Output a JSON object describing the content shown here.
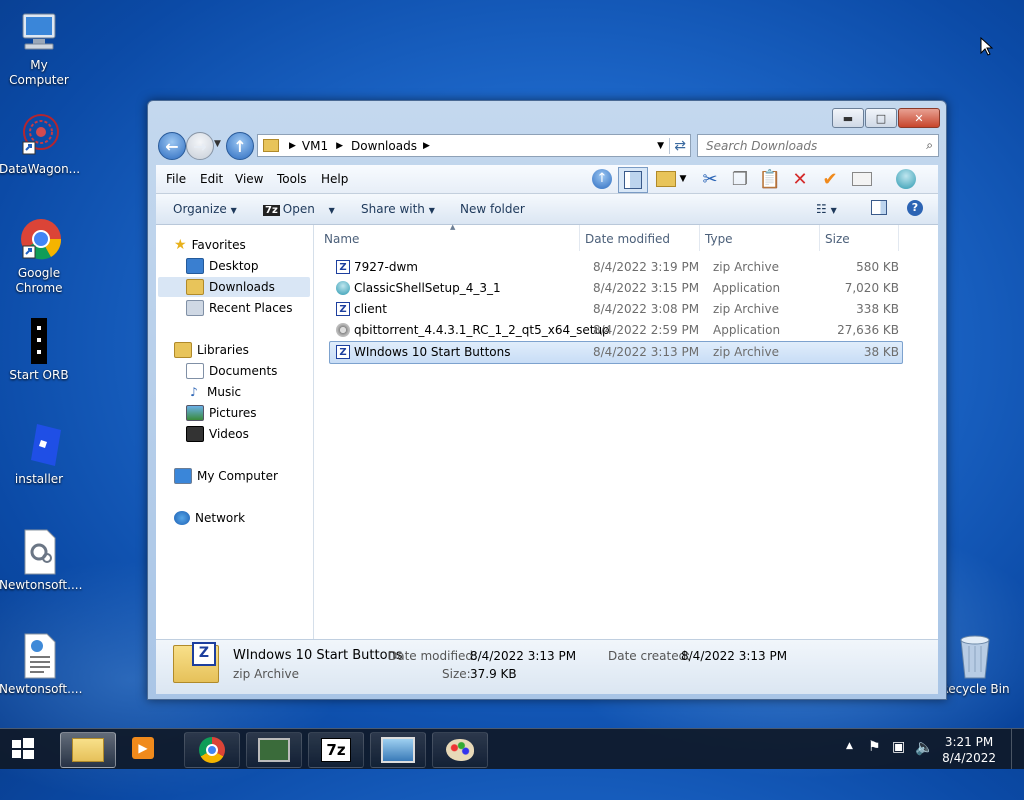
{
  "desktop": {
    "icons": [
      {
        "label": "My Computer"
      },
      {
        "label": "DataWagon..."
      },
      {
        "label": "Google Chrome"
      },
      {
        "label": "Start ORB"
      },
      {
        "label": "installer"
      },
      {
        "label": "Newtonsoft...."
      },
      {
        "label": "Newtonsoft...."
      },
      {
        "label": "Recycle Bin"
      }
    ]
  },
  "explorer": {
    "address": {
      "segments": [
        "VM1",
        "Downloads"
      ]
    },
    "search_placeholder": "Search Downloads",
    "menu": [
      "File",
      "Edit",
      "View",
      "Tools",
      "Help"
    ],
    "commands": {
      "organize": "Organize",
      "open": "Open",
      "share": "Share with",
      "new_folder": "New folder"
    },
    "nav": {
      "favorites": "Favorites",
      "desktop": "Desktop",
      "downloads": "Downloads",
      "recent": "Recent Places",
      "libraries": "Libraries",
      "documents": "Documents",
      "music": "Music",
      "pictures": "Pictures",
      "videos": "Videos",
      "computer": "My Computer",
      "network": "Network"
    },
    "columns": {
      "name": "Name",
      "date": "Date modified",
      "type": "Type",
      "size": "Size"
    },
    "files": [
      {
        "name": "7927-dwm",
        "date": "8/4/2022 3:19 PM",
        "type": "zip Archive",
        "size": "580 KB",
        "icon": "zip-icon"
      },
      {
        "name": "ClassicShellSetup_4_3_1",
        "date": "8/4/2022 3:15 PM",
        "type": "Application",
        "size": "7,020 KB",
        "icon": "shell-icon"
      },
      {
        "name": "client",
        "date": "8/4/2022 3:08 PM",
        "type": "zip Archive",
        "size": "338 KB",
        "icon": "zip-icon"
      },
      {
        "name": "qbittorrent_4.4.3.1_RC_1_2_qt5_x64_setup",
        "date": "8/4/2022 2:59 PM",
        "type": "Application",
        "size": "27,636 KB",
        "icon": "installer-icon"
      },
      {
        "name": "WIndows 10 Start Buttons",
        "date": "8/4/2022 3:13 PM",
        "type": "zip Archive",
        "size": "38 KB",
        "icon": "zip-icon"
      }
    ],
    "selected_index": 4,
    "details": {
      "name": "WIndows 10 Start Buttons",
      "type": "zip Archive",
      "modified_label": "Date modified:",
      "modified": "8/4/2022 3:13 PM",
      "created_label": "Date created:",
      "created": "8/4/2022 3:13 PM",
      "size_label": "Size:",
      "size": "37.9 KB"
    }
  },
  "taskbar": {
    "time": "3:21 PM",
    "date": "8/4/2022",
    "sevenzip_label": "7z"
  },
  "colors": {
    "accent": "#1d67c9",
    "selection": "#c8ddf6"
  }
}
